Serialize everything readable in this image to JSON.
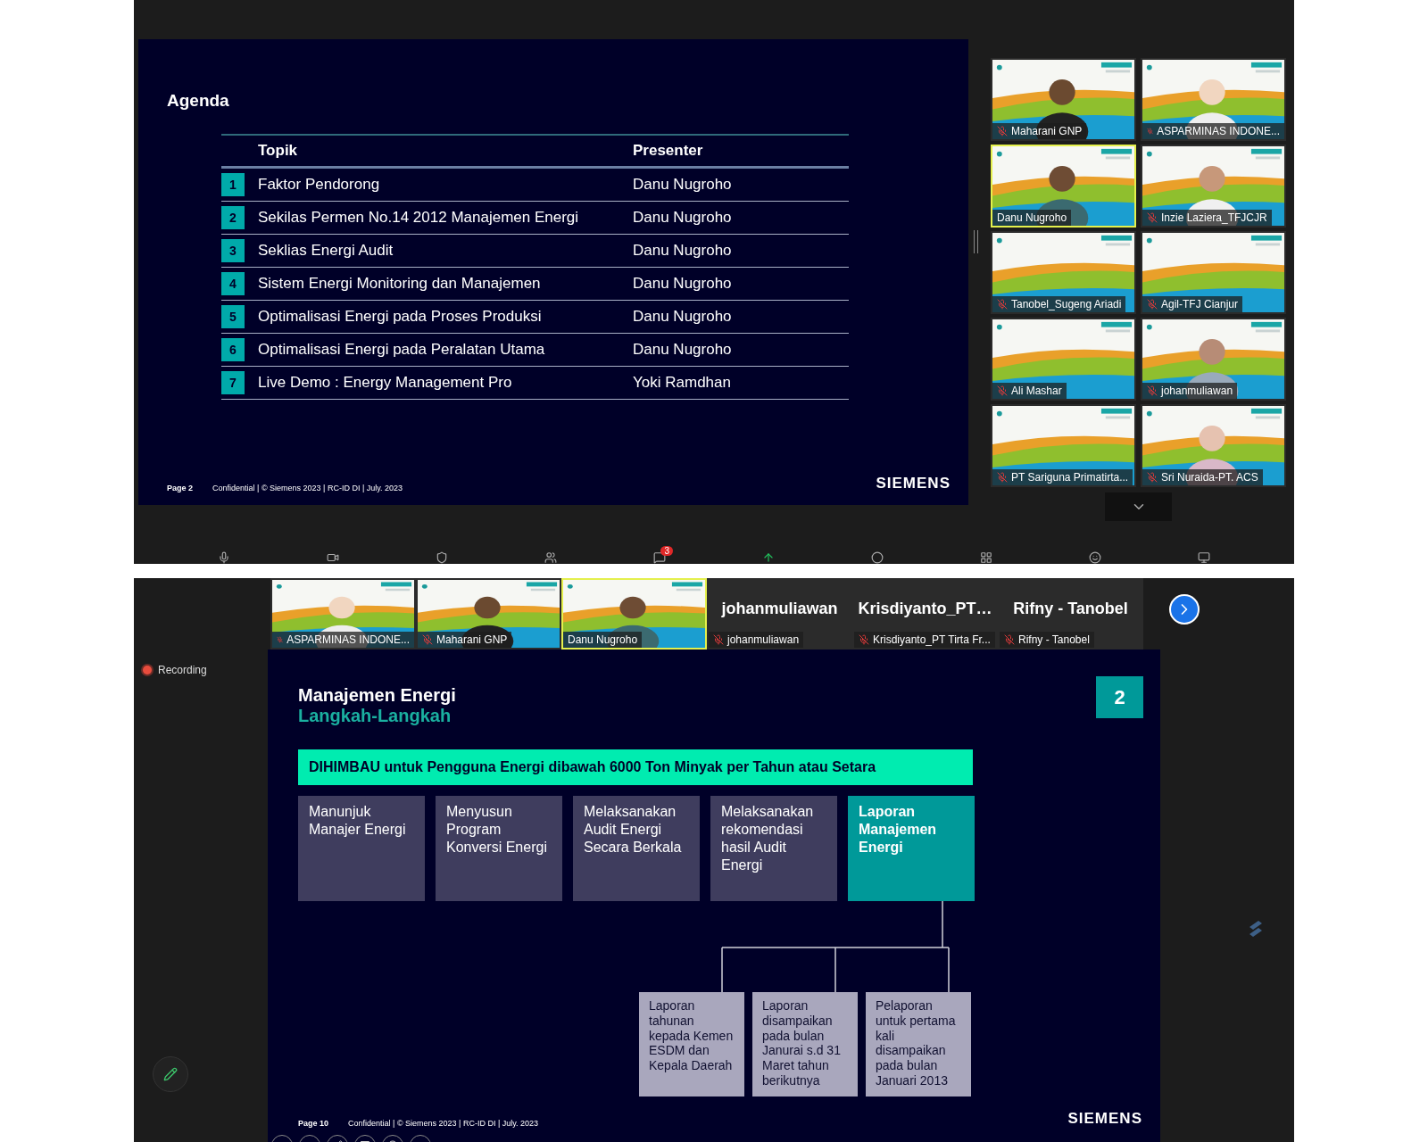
{
  "top_meeting": {
    "slide": {
      "title": "Agenda",
      "columns": [
        "Topik",
        "Presenter"
      ],
      "rows": [
        {
          "number": "1",
          "topic": "Faktor Pendorong",
          "presenter": "Danu Nugroho"
        },
        {
          "number": "2",
          "topic": "Sekilas Permen No.14 2012 Manajemen Energi",
          "presenter": "Danu Nugroho"
        },
        {
          "number": "3",
          "topic": "Seklias Energi Audit",
          "presenter": "Danu Nugroho"
        },
        {
          "number": "4",
          "topic": "Sistem Energi Monitoring dan Manajemen",
          "presenter": "Danu Nugroho"
        },
        {
          "number": "5",
          "topic": "Optimalisasi Energi pada Proses Produksi",
          "presenter": "Danu Nugroho"
        },
        {
          "number": "6",
          "topic": "Optimalisasi Energi pada Peralatan Utama",
          "presenter": "Danu Nugroho"
        },
        {
          "number": "7",
          "topic": "Live Demo : Energy Management Pro",
          "presenter": "Yoki Ramdhan"
        }
      ],
      "page": "Page 2",
      "footer": "Confidential | © Siemens 2023 | RC-ID DI | July. 2023",
      "logo": "SIEMENS"
    },
    "participants": [
      {
        "name": "Maharani GNP",
        "muted": true,
        "speaking": false
      },
      {
        "name": "ASPARMINAS INDONE...",
        "muted": true,
        "speaking": false
      },
      {
        "name": "Danu Nugroho",
        "muted": false,
        "speaking": true
      },
      {
        "name": "Inzie Laziera_TFJCJR",
        "muted": true,
        "speaking": false
      },
      {
        "name": "Tanobel_Sugeng Ariadi",
        "muted": true,
        "speaking": false
      },
      {
        "name": "Agil-TFJ Cianjur",
        "muted": true,
        "speaking": false
      },
      {
        "name": "Ali Mashar",
        "muted": true,
        "speaking": false
      },
      {
        "name": "johanmuliawan",
        "muted": true,
        "speaking": false
      },
      {
        "name": "PT Sariguna Primatirta...",
        "muted": true,
        "speaking": false
      },
      {
        "name": "Sri Nuraida-PT. ACS",
        "muted": true,
        "speaking": false
      }
    ],
    "toolbar": {
      "chat_badge": "3"
    }
  },
  "bottom_meeting": {
    "participants": [
      {
        "kind": "video",
        "name": "ASPARMINAS INDONE...",
        "muted": true,
        "speaking": false
      },
      {
        "kind": "video",
        "name": "Maharani GNP",
        "muted": true,
        "speaking": false
      },
      {
        "kind": "video",
        "name": "Danu Nugroho",
        "muted": false,
        "speaking": true
      },
      {
        "kind": "name",
        "display": "johanmuliawan",
        "name": "johanmuliawan",
        "muted": true,
        "speaking": false
      },
      {
        "kind": "name",
        "display": "Krisdiyanto_PT…",
        "name": "Krisdiyanto_PT Tirta Fr...",
        "muted": true,
        "speaking": false
      },
      {
        "kind": "name",
        "display": "Rifny - Tanobel",
        "name": "Rifny - Tanobel",
        "muted": true,
        "speaking": false
      }
    ],
    "recording": "Recording",
    "slide": {
      "title": "Manajemen Energi",
      "subtitle": "Langkah-Langkah",
      "badge": "2",
      "banner": "DIHIMBAU untuk Pengguna Energi dibawah 6000 Ton Minyak per Tahun atau Setara",
      "steps": [
        {
          "text": "Manunjuk Manajer Energi",
          "selected": false
        },
        {
          "text": "Menyusun Program Konversi Energi",
          "selected": false
        },
        {
          "text": "Melaksanakan Audit Energi Secara Berkala",
          "selected": false
        },
        {
          "text": "Melaksanakan rekomendasi hasil Audit Energi",
          "selected": false
        },
        {
          "text": "Laporan Manajemen Energi",
          "selected": true
        }
      ],
      "reports": [
        "Laporan tahunan kepada Kemen ESDM dan Kepala Daerah",
        "Laporan disampaikan pada bulan Janurai s.d 31 Maret tahun berikutnya",
        "Pelaporan untuk pertama kali disampaikan pada bulan Januari 2013"
      ],
      "page": "Page 10",
      "footer": "Confidential | © Siemens 2023 | RC-ID DI | July. 2023",
      "logo": "SIEMENS"
    }
  }
}
